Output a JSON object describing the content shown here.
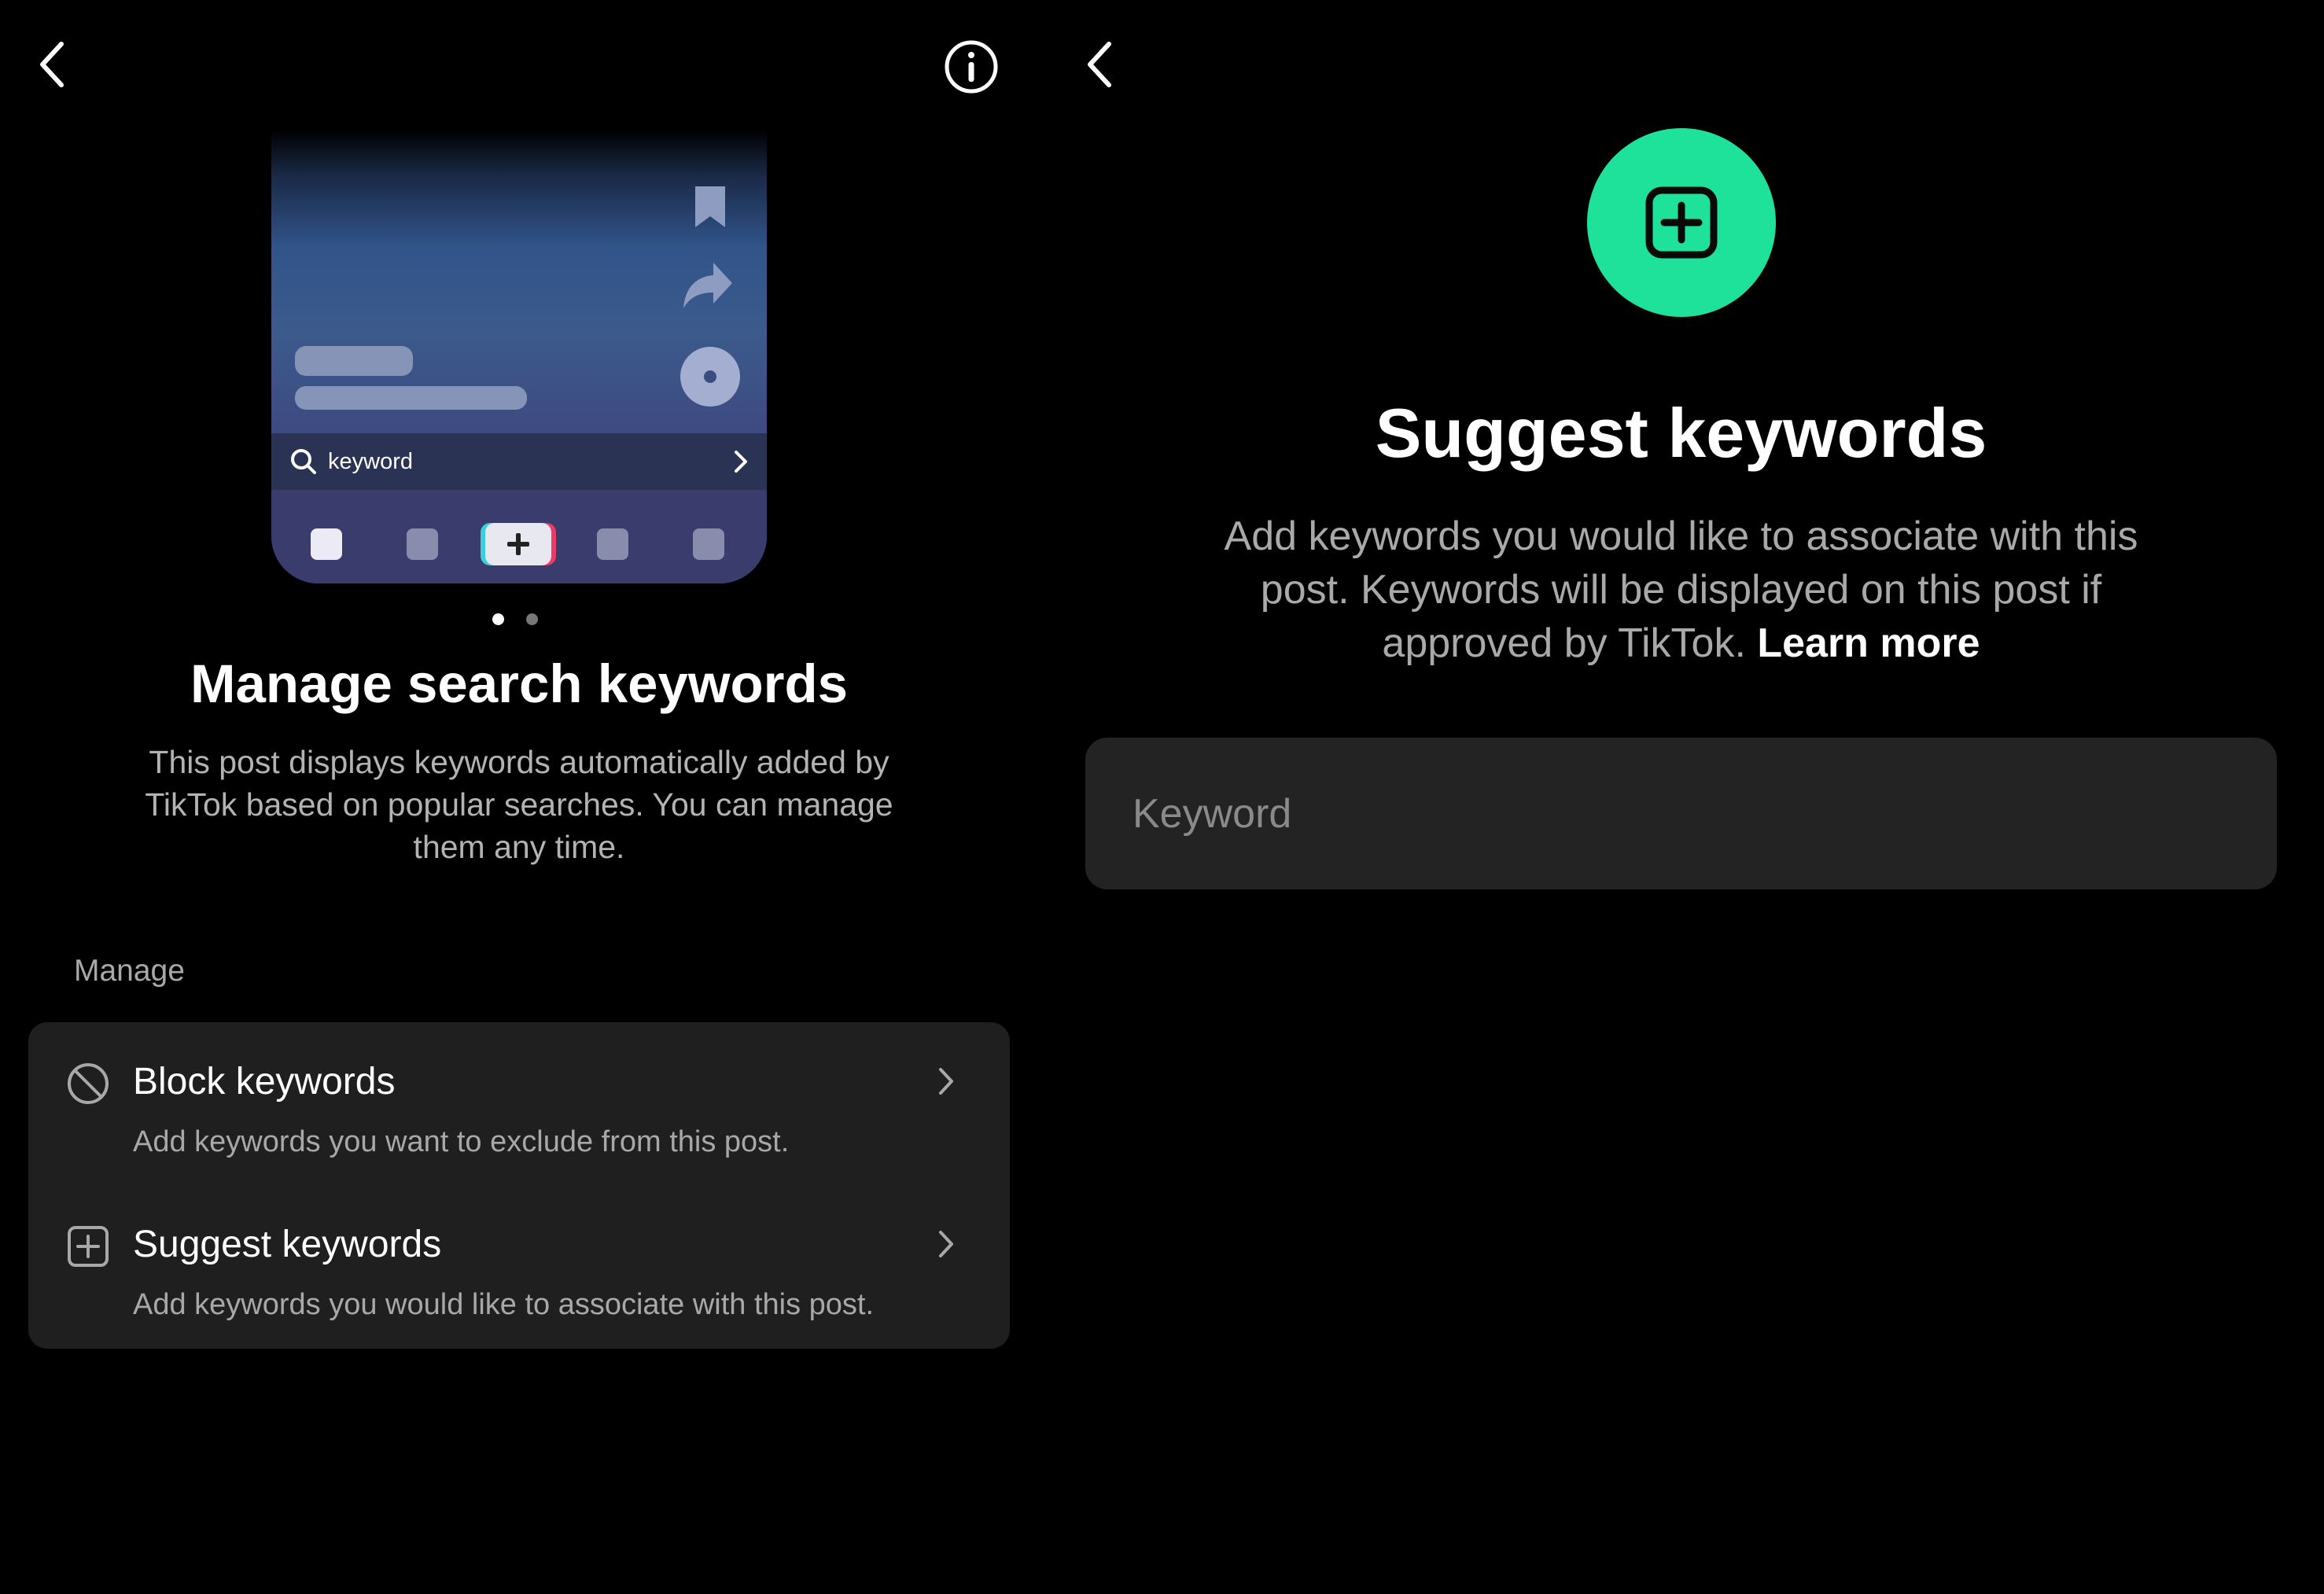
{
  "left_screen": {
    "illustration": {
      "search_text": "keyword"
    },
    "title": "Manage search keywords",
    "description": "This post displays keywords automatically added by TikTok based on popular searches. You can manage them any time.",
    "pager": {
      "total": 2,
      "active": 1
    },
    "section_label": "Manage",
    "options": [
      {
        "icon": "block-icon",
        "title": "Block keywords",
        "subtitle": "Add keywords you want to exclude from this post."
      },
      {
        "icon": "plus-square-icon",
        "title": "Suggest keywords",
        "subtitle": "Add keywords you would like to associate with this post."
      }
    ]
  },
  "right_screen": {
    "title": "Suggest keywords",
    "description": "Add keywords you would like to associate with this post. Keywords will be displayed on this post if approved by TikTok.",
    "learn_more": "Learn more",
    "input": {
      "placeholder": "Keyword",
      "value": ""
    }
  },
  "colors": {
    "background": "#000000",
    "card": "#1f1f1f",
    "accent_green": "#1fe29a",
    "secondary_text": "#a9a9a9"
  }
}
